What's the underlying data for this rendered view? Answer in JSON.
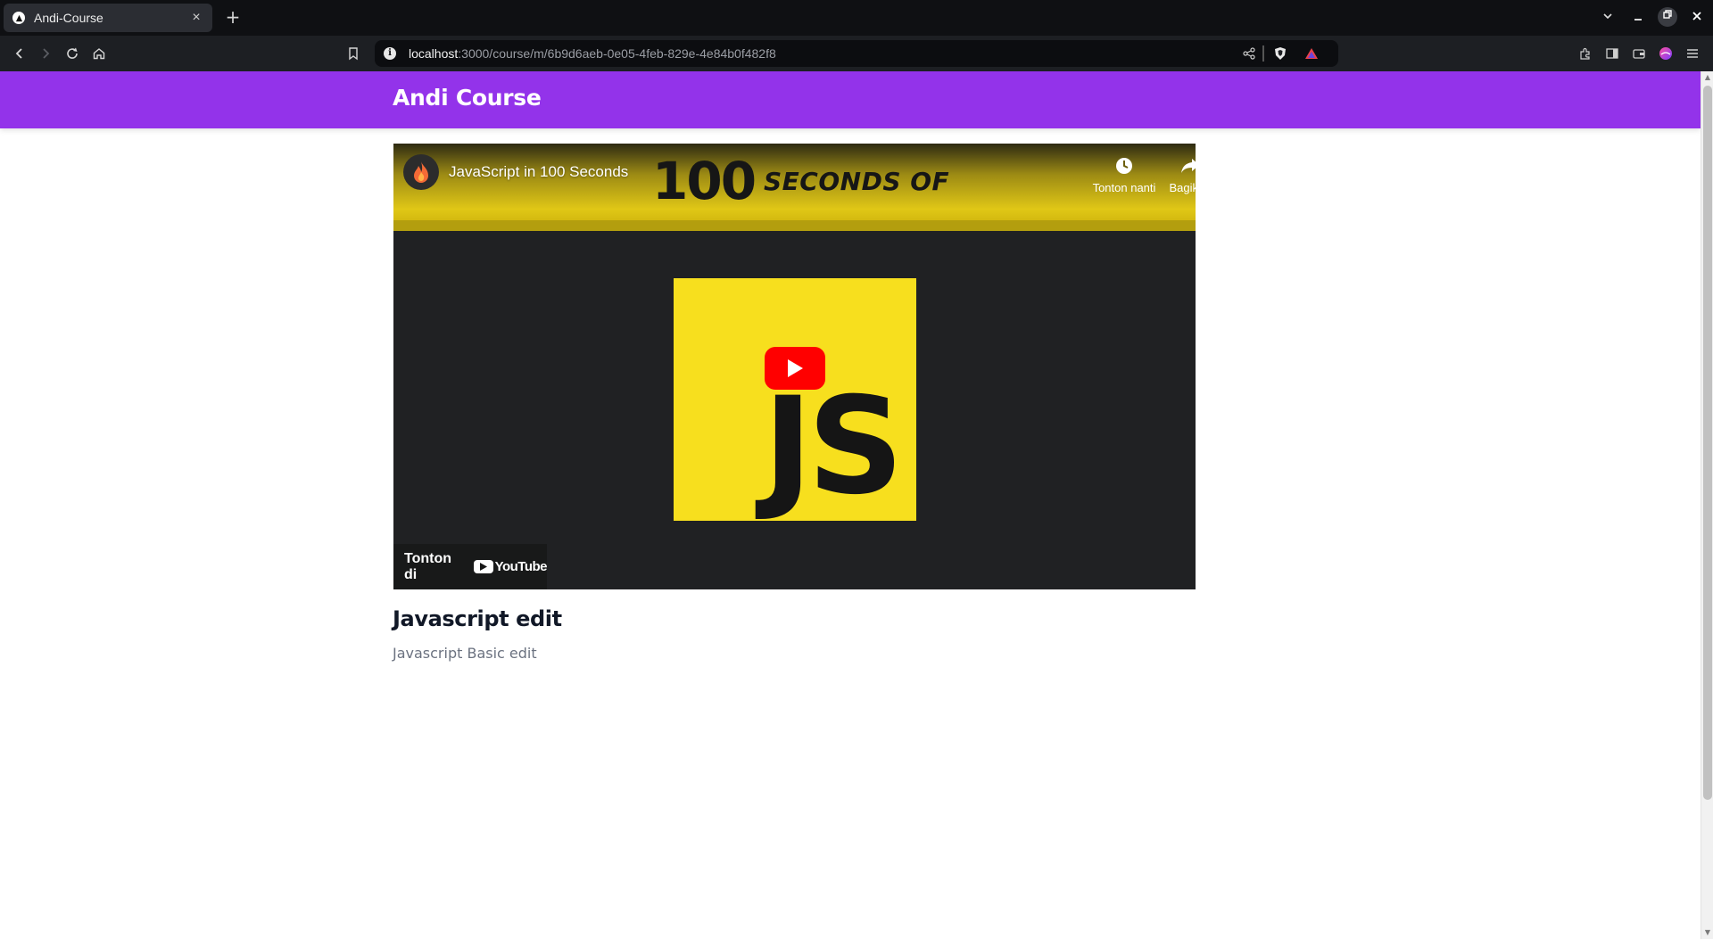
{
  "browser": {
    "tab_title": "Andi-Course",
    "new_tab_symbol": "+",
    "url_host": "localhost",
    "url_path": ":3000/course/m/6b9d6aeb-0e05-4feb-829e-4e84b0f482f8"
  },
  "app": {
    "brand": "Andi Course",
    "brand_color": "#9333ea"
  },
  "video": {
    "title": "JavaScript in 100 Seconds",
    "thumbnail_number": "100",
    "thumbnail_text": "SECONDS OF",
    "logo_text": "JS",
    "watch_later_label": "Tonton nanti",
    "share_label": "Bagikan",
    "watch_on_label": "Tonton di",
    "youtube_word": "YouTube"
  },
  "module": {
    "title": "Javascript edit",
    "description": "Javascript Basic edit"
  }
}
